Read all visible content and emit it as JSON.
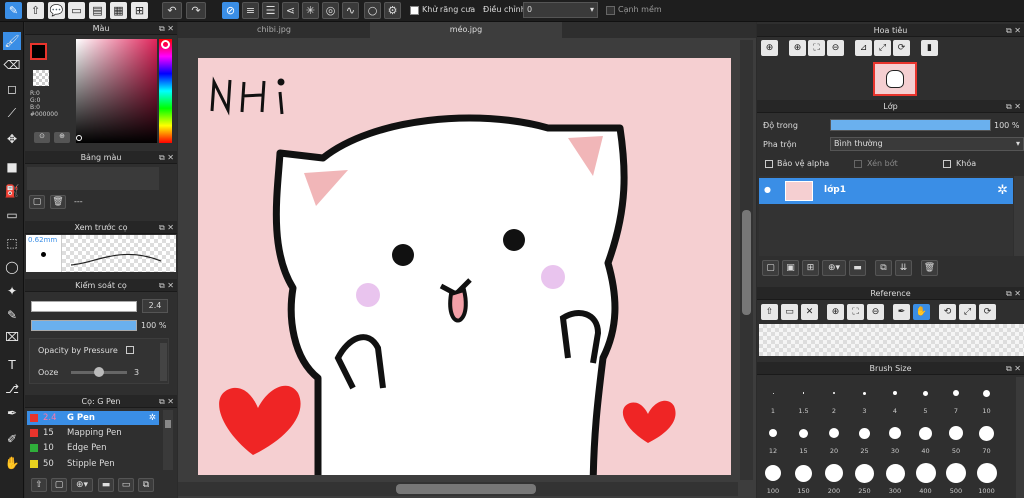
{
  "toolbar": {
    "antialias_label": "Khử răng cưa",
    "adjust_label": "Điều chỉnh",
    "adjust_value": "0",
    "edge_label": "Cạnh mềm"
  },
  "tabs": [
    {
      "label": "chibi.jpg"
    },
    {
      "label": "méo.jpg"
    }
  ],
  "color_panel": {
    "title": "Màu",
    "r": "R:0",
    "g": "G:0",
    "b": "B:0",
    "hex": "#000000",
    "fg_color": "#000000",
    "accent": "#3a8ee6"
  },
  "palette_panel": {
    "title": "Bảng màu",
    "value": "---"
  },
  "brush_preview_panel": {
    "title": "Xem trước cọ",
    "size": "0.62mm"
  },
  "brush_control_panel": {
    "title": "Kiểm soát cọ",
    "size_value": "2.4",
    "opacity_value": "100 %",
    "opacity_pressure_label": "Opacity by Pressure",
    "ooze_label": "Ooze",
    "ooze_value": "3",
    "ooze_level": 0.5
  },
  "brush_list_panel": {
    "title": "Cọ: G Pen",
    "items": [
      {
        "size": "2.4",
        "name": "G Pen",
        "color": "#e8342c"
      },
      {
        "size": "15",
        "name": "Mapping Pen",
        "color": "#e8342c"
      },
      {
        "size": "10",
        "name": "Edge Pen",
        "color": "#2fae3a"
      },
      {
        "size": "50",
        "name": "Stipple Pen",
        "color": "#e8d21f"
      }
    ]
  },
  "navigator_panel": {
    "title": "Hoa tiêu"
  },
  "layer_panel": {
    "title": "Lớp",
    "opacity_label": "Độ trong",
    "opacity_value": "100 %",
    "opacity_level": 1.0,
    "blend_label": "Pha trộn",
    "blend_value": "Bình thường",
    "protect_alpha": "Bảo vệ alpha",
    "clipping": "Xén bớt",
    "lock": "Khóa",
    "layers": [
      {
        "name": "lớp1"
      }
    ]
  },
  "reference_panel": {
    "title": "Reference"
  },
  "brush_size_panel": {
    "title": "Brush Size",
    "sizes": [
      "1",
      "1.5",
      "2",
      "3",
      "4",
      "5",
      "7",
      "10",
      "12",
      "15",
      "20",
      "25",
      "30",
      "40",
      "50",
      "70",
      "100",
      "150",
      "200",
      "250",
      "300",
      "400",
      "500",
      "1000"
    ]
  },
  "canvas": {
    "handwriting": "NHI",
    "background": "#f5cfd1"
  }
}
